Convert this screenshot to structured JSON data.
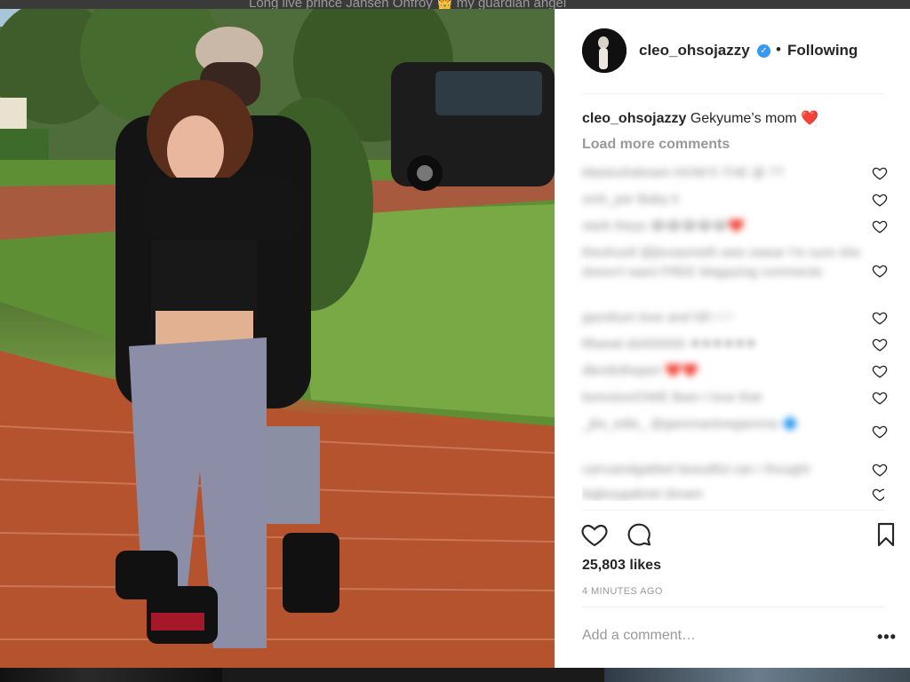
{
  "top_caption": "Long live prince Jahseh Onfroy 👑 my guardian angel",
  "post": {
    "username": "cleo_ohsojazzy",
    "separator": "•",
    "follow_status": "Following",
    "verified_icon": "✓",
    "caption_user": "cleo_ohsojazzy",
    "caption_text": "Gekyume’s mom",
    "caption_emoji": "❤️",
    "load_more": "Load more comments",
    "comments": [
      {
        "text": "blastoohdream HOW'S THE @ ??"
      },
      {
        "text": "smh_per Baby it"
      },
      {
        "text": "stark theys 😂😂😂😂😂❤️"
      },
      {
        "text": "theshootl @jlovasmeth wee swear I'm sure she doesn't want FREE Magazing comments"
      },
      {
        "text": "gazelium love and hill ! ! !"
      },
      {
        "text": "fifwewt dohhhhhh ⚫⚫⚫⚫⚫⚫"
      },
      {
        "text": "dlentlolheperi ❤️❤️"
      },
      {
        "text": "boresion/OWE Bam I love that"
      },
      {
        "text": "_jbs_edts_ @gammaninegamma 🔷"
      },
      {
        "text": "carruandgabbel beautiful can I thought"
      },
      {
        "text": "bigboygabriel dream"
      }
    ],
    "likes": "25,803 likes",
    "timestamp": "4 MINUTES AGO",
    "add_comment_placeholder": "Add a comment…",
    "more_options": "•••"
  },
  "colors": {
    "verified": "#3897f0",
    "heart": "#ed2a3a",
    "secondary_text": "#999999"
  },
  "icons": {
    "like": "heart-outline-icon",
    "comment": "speech-bubble-icon",
    "save": "bookmark-icon",
    "comment_like": "small-heart-outline-icon"
  }
}
